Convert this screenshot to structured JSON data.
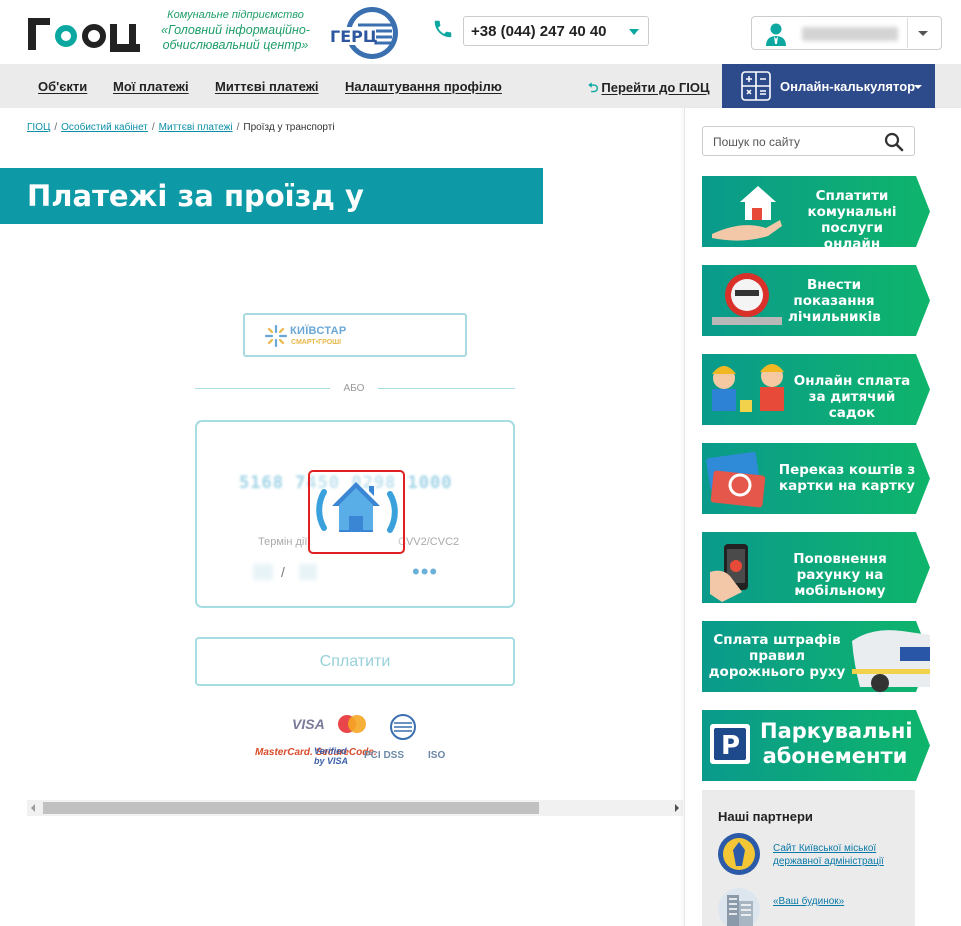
{
  "header": {
    "logo_text": "ГІОЦ",
    "org_line1": "Комунальне підприємство",
    "org_line2": "«Головний інформаційно-обчислювальний центр»",
    "gerc_logo_text": "ГЕРЦ",
    "phone": "+38 (044) 247 40 40",
    "user_name": "",
    "brand_color": "#0ba7a0"
  },
  "nav": {
    "items": [
      "Об'єкти",
      "Мої платежі",
      "Миттєві платежі",
      "Налаштування профілю"
    ],
    "goto_label": "Перейти до ГІОЦ",
    "calculator_label": "Онлайн-калькулятор"
  },
  "breadcrumb": {
    "items": [
      "ГІОЦ",
      "Особистий кабінет",
      "Миттєві платежі"
    ],
    "current": "Проїзд у транспорті"
  },
  "page": {
    "title": "Платежі за проїзд у транспорті"
  },
  "payment": {
    "kyivstar_label": "КИЇВСТАР",
    "kyivstar_sub": "СМАРТ•ГРОШІ",
    "or_label": "АБО",
    "card_number": "5168 7450 0298 1000",
    "expiry_label": "Термін дії",
    "cvv_label": "CVV2/CVC2",
    "expiry_separator": "/",
    "cvv_masked": "•••",
    "pay_button": "Сплатити",
    "logos": [
      "VISA",
      "MasterCard",
      "ГЕРЦ",
      "MasterCard. SecureCode.",
      "Verified by VISA",
      "PCI DSS",
      "ISO"
    ]
  },
  "sidebar": {
    "search_placeholder": "Пошук по сайту",
    "promos": [
      {
        "label": "Сплатити комунальні послуги онлайн",
        "color": "#0aa38a"
      },
      {
        "label": "Внести показання лічильників",
        "color": "#0aa38a"
      },
      {
        "label": "Онлайн сплата за дитячий садок",
        "color": "#0aa38a"
      },
      {
        "label": "Переказ коштів з картки на картку",
        "color": "#0aa38a"
      },
      {
        "label": "Поповнення рахунку на мобільному",
        "color": "#0aa38a"
      },
      {
        "label": "Сплата штрафів правил дорожнього руху",
        "color": "#0aa38a"
      },
      {
        "label": "Паркувальні абонементи",
        "color": "#0aa38a"
      }
    ],
    "partners": {
      "heading": "Наші партнери",
      "items": [
        "Сайт Київської міської державної адміністрації",
        "«Ваш будинок»"
      ]
    }
  }
}
